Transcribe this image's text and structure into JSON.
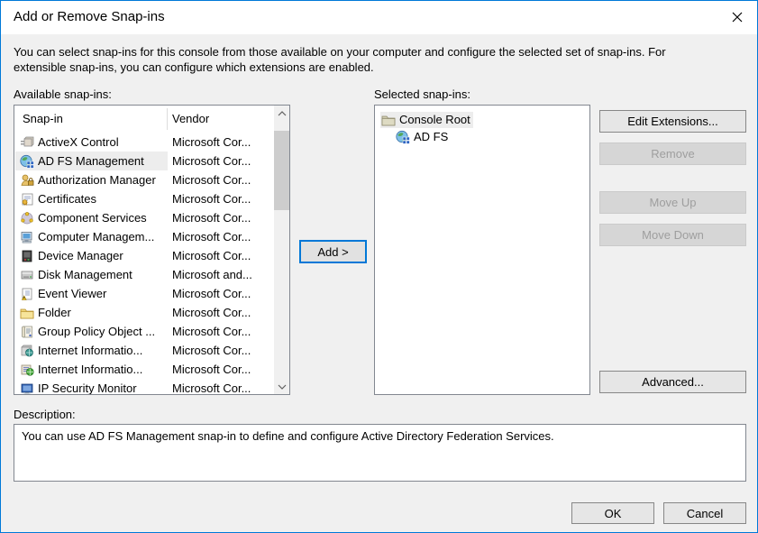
{
  "window": {
    "title": "Add or Remove Snap-ins"
  },
  "colors": {
    "accent_border": "#0079d8",
    "titlebar_bg": "#ffffff",
    "dialog_bg": "#f0f0f0",
    "selection_bg": "#ededed",
    "disabled_text": "#9e9e9e",
    "add_button_focus": "#0078d7"
  },
  "intro": {
    "text": "You can select snap-ins for this console from those available on your computer and configure the selected set of snap-ins. For\nextensible snap-ins, you can configure which extensions are enabled."
  },
  "available": {
    "label": "Available snap-ins:",
    "columns": [
      "Snap-in",
      "Vendor"
    ],
    "rows": [
      {
        "name": "ActiveX Control",
        "vendor": "Microsoft Cor...",
        "icon": "activex-control"
      },
      {
        "name": "AD FS Management",
        "vendor": "Microsoft Cor...",
        "icon": "adfs-globe",
        "selected": true
      },
      {
        "name": "Authorization Manager",
        "vendor": "Microsoft Cor...",
        "icon": "authorization-manager"
      },
      {
        "name": "Certificates",
        "vendor": "Microsoft Cor...",
        "icon": "certificates"
      },
      {
        "name": "Component Services",
        "vendor": "Microsoft Cor...",
        "icon": "component-services"
      },
      {
        "name": "Computer Managem...",
        "vendor": "Microsoft Cor...",
        "icon": "computer-management"
      },
      {
        "name": "Device Manager",
        "vendor": "Microsoft Cor...",
        "icon": "device-manager"
      },
      {
        "name": "Disk Management",
        "vendor": "Microsoft and...",
        "icon": "disk-management"
      },
      {
        "name": "Event Viewer",
        "vendor": "Microsoft Cor...",
        "icon": "event-viewer"
      },
      {
        "name": "Folder",
        "vendor": "Microsoft Cor...",
        "icon": "folder"
      },
      {
        "name": "Group Policy Object ...",
        "vendor": "Microsoft Cor...",
        "icon": "group-policy"
      },
      {
        "name": "Internet Informatio...",
        "vendor": "Microsoft Cor...",
        "icon": "iis-globe"
      },
      {
        "name": "Internet Informatio...",
        "vendor": "Microsoft Cor...",
        "icon": "iis-box"
      },
      {
        "name": "IP Security Monitor",
        "vendor": "Microsoft Cor...",
        "icon": "ip-security"
      }
    ]
  },
  "selected_panel": {
    "label": "Selected snap-ins:",
    "nodes": [
      {
        "label": "Console Root",
        "icon": "console-root-folder",
        "indent": 0,
        "highlighted": true
      },
      {
        "label": "AD FS",
        "icon": "adfs-globe",
        "indent": 1,
        "highlighted": false
      }
    ]
  },
  "buttons": {
    "add": "Add >",
    "edit_extensions": "Edit Extensions...",
    "remove": "Remove",
    "move_up": "Move Up",
    "move_down": "Move Down",
    "advanced": "Advanced...",
    "ok": "OK",
    "cancel": "Cancel"
  },
  "description": {
    "label": "Description:",
    "text": "You can use AD FS Management snap-in to define and configure Active Directory Federation Services."
  }
}
